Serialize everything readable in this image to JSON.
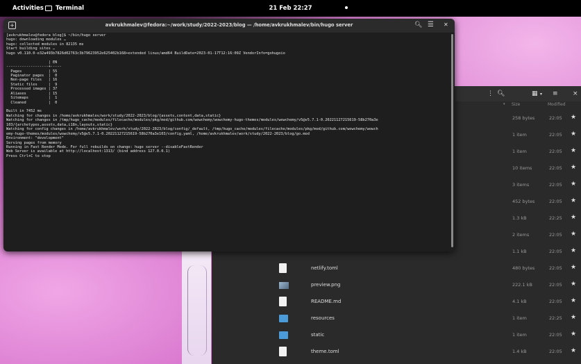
{
  "topbar": {
    "activities": "Activities",
    "app_name": "Terminal",
    "clock": "21 Feb  22:27"
  },
  "terminal": {
    "title": "avkrukhmalev@fedora:~/work/study/2022-2023/blog — /home/avkrukhmalev/bin/hugo server",
    "lines": [
      "[avkrukhmalev@fedora blog]$ ~/bin/hugo server",
      "hugo: downloading modules …",
      "hugo: collected modules in 82135 ms",
      "Start building sites …",
      "hugo v0.110.0-e32a493b7826d02763c3b79623952e625402b168+extended linux/amd64 BuildDate=2023-01-17T12:16:09Z VendorInfo=gohugoio",
      "",
      "                   | EN",
      "-------------------+-----",
      "  Pages            | 55",
      "  Paginator pages  |  0",
      "  Non-page files   | 16",
      "  Static files     |  9",
      "  Processed images | 37",
      "  Aliases          | 15",
      "  Sitemaps         |  1",
      "  Cleaned          |  0",
      "",
      "Built in 7452 ms",
      "Watching for changes in /home/avkrukhmalev/work/study/2022-2023/blog/{assets,content,data,static}",
      "Watching for changes in /tmp/hugo_cache/modules/filecache/modules/pkg/mod/github.com/wowchemy/wowchemy-hugo-themes/modules/wowchemy/v5@v5.7.1-0.20221127215619-58b270a3e",
      "103/{archetypes,assets,data,i18n,layouts,static}",
      "Watching for config changes in /home/avkrukhmalev/work/study/2022-2023/blog/config/_default, /tmp/hugo_cache/modules/filecache/modules/pkg/mod/github.com/wowchemy/wowch",
      "emy-hugo-themes/modules/wowchemy/v5@v5.7.1-0.20221127215619-58b270a3e103/config.yaml, /home/avkrukhmalev/work/study/2022-2023/blog/go.mod",
      "Environment: \"development\"",
      "Serving pages from memory",
      "Running in Fast Render Mode. For full rebuilds on change: hugo server --disableFastRender",
      "Web Server is available at http://localhost:1313/ (bind address 127.0.0.1)",
      "Press Ctrl+C to stop"
    ]
  },
  "files": {
    "col_size": "Size",
    "col_modified": "Modified",
    "rows": [
      {
        "name": "",
        "size": "258 bytes",
        "modified": "22:05",
        "icon": "none"
      },
      {
        "name": "",
        "size": "1 item",
        "modified": "22:05",
        "icon": "none"
      },
      {
        "name": "",
        "size": "1 item",
        "modified": "22:05",
        "icon": "none"
      },
      {
        "name": "",
        "size": "10 items",
        "modified": "22:05",
        "icon": "none"
      },
      {
        "name": "",
        "size": "3 items",
        "modified": "22:05",
        "icon": "none"
      },
      {
        "name": "",
        "size": "452 bytes",
        "modified": "22:05",
        "icon": "none"
      },
      {
        "name": "",
        "size": "1.3 kB",
        "modified": "22:25",
        "icon": "none"
      },
      {
        "name": "",
        "size": "2 items",
        "modified": "22:05",
        "icon": "none"
      },
      {
        "name": "",
        "size": "1.1 kB",
        "modified": "22:05",
        "icon": "none"
      },
      {
        "name": "netlify.toml",
        "size": "480 bytes",
        "modified": "22:05",
        "icon": "doc"
      },
      {
        "name": "preview.png",
        "size": "222.1 kB",
        "modified": "22:05",
        "icon": "img"
      },
      {
        "name": "README.md",
        "size": "4.1 kB",
        "modified": "22:05",
        "icon": "doc"
      },
      {
        "name": "resources",
        "size": "1 item",
        "modified": "22:25",
        "icon": "folder"
      },
      {
        "name": "static",
        "size": "1 item",
        "modified": "22:05",
        "icon": "folder"
      },
      {
        "name": "theme.toml",
        "size": "1.4 kB",
        "modified": "22:05",
        "icon": "doc"
      }
    ]
  }
}
